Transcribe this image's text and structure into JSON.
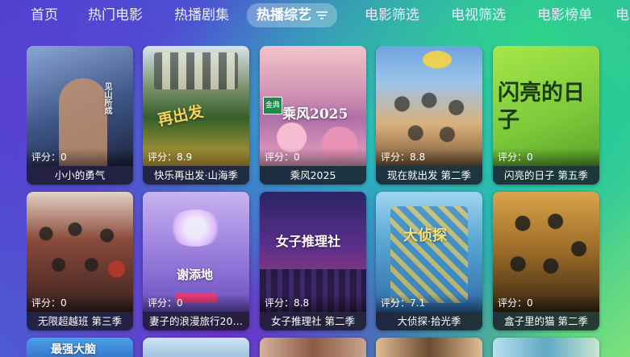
{
  "nav": {
    "items": [
      "首页",
      "热门电影",
      "热播剧集",
      "热播综艺",
      "电影筛选",
      "电视筛选",
      "电影榜单",
      "电"
    ],
    "active_index": 3
  },
  "cards_row1": [
    {
      "title": "小小的勇气",
      "score": "评分：0",
      "poster_text": "见山所成",
      "colors": [
        "#2c3e63",
        "#c49a7a"
      ]
    },
    {
      "title": "快乐再出发·山海季",
      "score": "评分：8.9",
      "poster_text": "再出发",
      "colors": [
        "#3b6b30",
        "#d9b63c"
      ]
    },
    {
      "title": "乘风2025",
      "score": "评分：0",
      "poster_text": "乘风2025",
      "badge": "金典",
      "colors": [
        "#e8b2c6",
        "#8f6fb0"
      ]
    },
    {
      "title": "现在就出发 第二季",
      "score": "评分：8.8",
      "poster_text": "",
      "colors": [
        "#4f7ec4",
        "#c7a36a"
      ]
    },
    {
      "title": "闪亮的日子 第五季",
      "score": "评分：0",
      "poster_text": "闪亮的日子",
      "colors": [
        "#8ed13a",
        "#5aa22a"
      ]
    }
  ],
  "cards_row2": [
    {
      "title": "无限超越班 第三季",
      "score": "评分：0",
      "poster_text": "",
      "colors": [
        "#6a2f2a",
        "#c2482f"
      ]
    },
    {
      "title": "妻子的浪漫旅行20…",
      "score": "评分：0",
      "poster_text": "谢添地",
      "colors": [
        "#b59ae6",
        "#7b5cc9"
      ]
    },
    {
      "title": "女子推理社 第二季",
      "score": "评分：8.8",
      "poster_text": "女子推理社",
      "colors": [
        "#3a2c86",
        "#b23b7a"
      ]
    },
    {
      "title": "大侦探·拾光季",
      "score": "评分：7.1",
      "poster_text": "大侦探",
      "colors": [
        "#4aa3d0",
        "#d8c15a"
      ]
    },
    {
      "title": "盒子里的猫 第二季",
      "score": "评分：0",
      "poster_text": "",
      "colors": [
        "#5d4420",
        "#d29a30"
      ]
    }
  ],
  "cards_row3": [
    {
      "title": "",
      "poster_text": "最强大脑",
      "colors": [
        "#3a8fe0",
        "#2b5fb8"
      ]
    },
    {
      "title": "",
      "poster_text": "",
      "colors": [
        "#bcd9f0",
        "#7fb0d6"
      ]
    },
    {
      "title": "",
      "poster_text": "",
      "colors": [
        "#c9a58f",
        "#8c5a45"
      ]
    },
    {
      "title": "",
      "poster_text": "",
      "colors": [
        "#d7b08a",
        "#6b4a30"
      ]
    },
    {
      "title": "",
      "poster_text": "",
      "colors": [
        "#a9d8e8",
        "#5fa9c4"
      ]
    }
  ],
  "icons": {
    "filter": "filter-icon"
  }
}
